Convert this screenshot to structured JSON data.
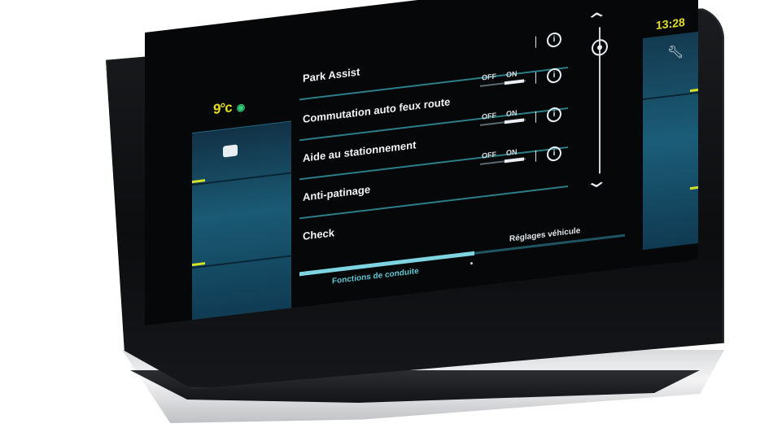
{
  "status": {
    "temperature": "9°c",
    "clock": "13:28"
  },
  "settings": {
    "items": [
      {
        "label": "Park Assist",
        "has_toggle": false
      },
      {
        "label": "Commutation auto feux route",
        "has_toggle": true,
        "off_label": "OFF",
        "on_label": "ON",
        "state": "on"
      },
      {
        "label": "Aide au stationnement",
        "has_toggle": true,
        "off_label": "OFF",
        "on_label": "ON",
        "state": "on"
      },
      {
        "label": "Anti-patinage",
        "has_toggle": true,
        "off_label": "OFF",
        "on_label": "ON",
        "state": "on"
      },
      {
        "label": "Check",
        "has_toggle": false
      }
    ]
  },
  "tabs": {
    "left": "Fonctions de conduite",
    "right": "Réglages véhicule",
    "active": "left"
  },
  "icons": {
    "left_panel": "message-icon",
    "right_panel": "wrench-icon",
    "location": "location-pin-icon",
    "info": "info-icon",
    "scroll_up": "chevron-up-icon",
    "scroll_down": "chevron-down-icon"
  },
  "colors": {
    "accent_yellow": "#e4e01c",
    "accent_teal": "#2b7f8a",
    "active_tab": "#7fd4e2"
  }
}
